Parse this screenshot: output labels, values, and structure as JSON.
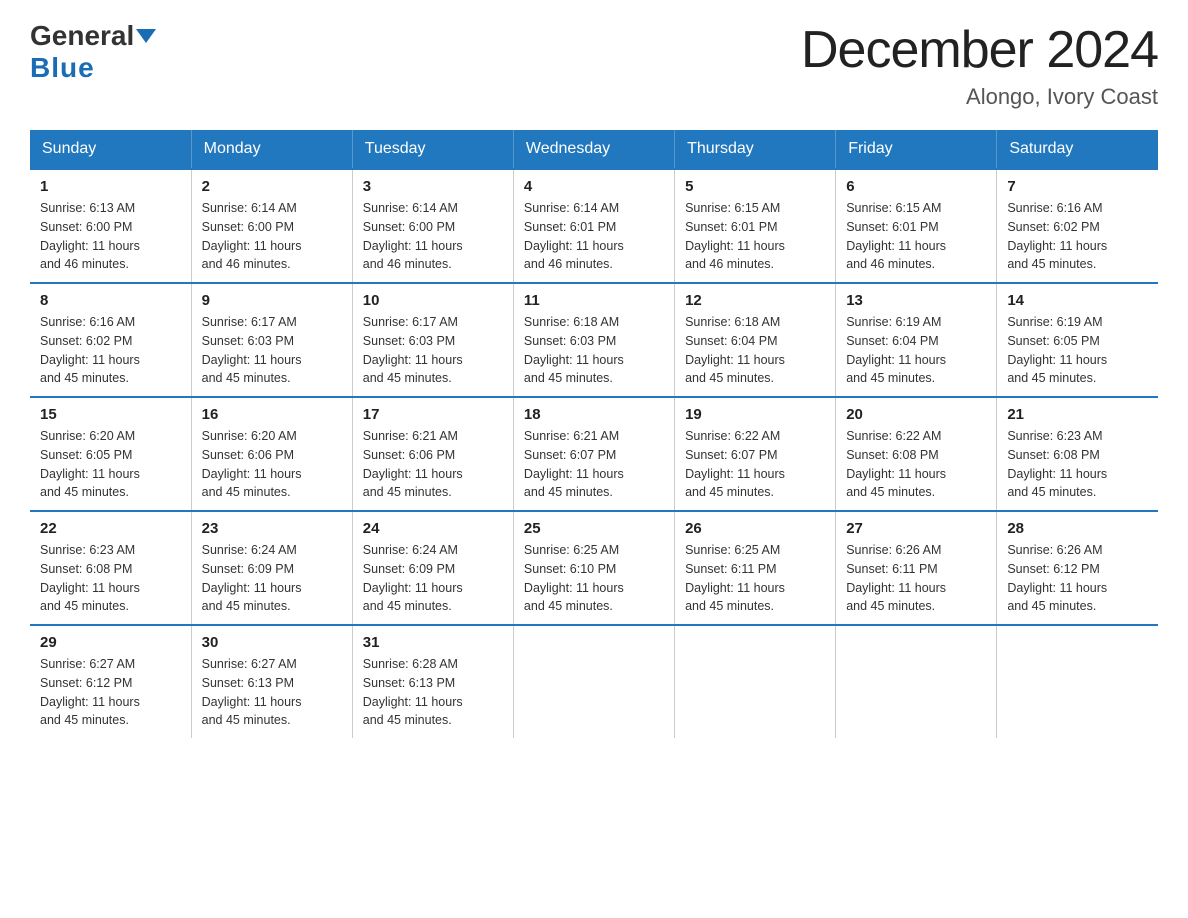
{
  "logo": {
    "general": "General",
    "blue": "Blue"
  },
  "title": "December 2024",
  "location": "Alongo, Ivory Coast",
  "headers": [
    "Sunday",
    "Monday",
    "Tuesday",
    "Wednesday",
    "Thursday",
    "Friday",
    "Saturday"
  ],
  "weeks": [
    [
      {
        "day": "1",
        "sunrise": "6:13 AM",
        "sunset": "6:00 PM",
        "daylight": "11 hours and 46 minutes."
      },
      {
        "day": "2",
        "sunrise": "6:14 AM",
        "sunset": "6:00 PM",
        "daylight": "11 hours and 46 minutes."
      },
      {
        "day": "3",
        "sunrise": "6:14 AM",
        "sunset": "6:00 PM",
        "daylight": "11 hours and 46 minutes."
      },
      {
        "day": "4",
        "sunrise": "6:14 AM",
        "sunset": "6:01 PM",
        "daylight": "11 hours and 46 minutes."
      },
      {
        "day": "5",
        "sunrise": "6:15 AM",
        "sunset": "6:01 PM",
        "daylight": "11 hours and 46 minutes."
      },
      {
        "day": "6",
        "sunrise": "6:15 AM",
        "sunset": "6:01 PM",
        "daylight": "11 hours and 46 minutes."
      },
      {
        "day": "7",
        "sunrise": "6:16 AM",
        "sunset": "6:02 PM",
        "daylight": "11 hours and 45 minutes."
      }
    ],
    [
      {
        "day": "8",
        "sunrise": "6:16 AM",
        "sunset": "6:02 PM",
        "daylight": "11 hours and 45 minutes."
      },
      {
        "day": "9",
        "sunrise": "6:17 AM",
        "sunset": "6:03 PM",
        "daylight": "11 hours and 45 minutes."
      },
      {
        "day": "10",
        "sunrise": "6:17 AM",
        "sunset": "6:03 PM",
        "daylight": "11 hours and 45 minutes."
      },
      {
        "day": "11",
        "sunrise": "6:18 AM",
        "sunset": "6:03 PM",
        "daylight": "11 hours and 45 minutes."
      },
      {
        "day": "12",
        "sunrise": "6:18 AM",
        "sunset": "6:04 PM",
        "daylight": "11 hours and 45 minutes."
      },
      {
        "day": "13",
        "sunrise": "6:19 AM",
        "sunset": "6:04 PM",
        "daylight": "11 hours and 45 minutes."
      },
      {
        "day": "14",
        "sunrise": "6:19 AM",
        "sunset": "6:05 PM",
        "daylight": "11 hours and 45 minutes."
      }
    ],
    [
      {
        "day": "15",
        "sunrise": "6:20 AM",
        "sunset": "6:05 PM",
        "daylight": "11 hours and 45 minutes."
      },
      {
        "day": "16",
        "sunrise": "6:20 AM",
        "sunset": "6:06 PM",
        "daylight": "11 hours and 45 minutes."
      },
      {
        "day": "17",
        "sunrise": "6:21 AM",
        "sunset": "6:06 PM",
        "daylight": "11 hours and 45 minutes."
      },
      {
        "day": "18",
        "sunrise": "6:21 AM",
        "sunset": "6:07 PM",
        "daylight": "11 hours and 45 minutes."
      },
      {
        "day": "19",
        "sunrise": "6:22 AM",
        "sunset": "6:07 PM",
        "daylight": "11 hours and 45 minutes."
      },
      {
        "day": "20",
        "sunrise": "6:22 AM",
        "sunset": "6:08 PM",
        "daylight": "11 hours and 45 minutes."
      },
      {
        "day": "21",
        "sunrise": "6:23 AM",
        "sunset": "6:08 PM",
        "daylight": "11 hours and 45 minutes."
      }
    ],
    [
      {
        "day": "22",
        "sunrise": "6:23 AM",
        "sunset": "6:08 PM",
        "daylight": "11 hours and 45 minutes."
      },
      {
        "day": "23",
        "sunrise": "6:24 AM",
        "sunset": "6:09 PM",
        "daylight": "11 hours and 45 minutes."
      },
      {
        "day": "24",
        "sunrise": "6:24 AM",
        "sunset": "6:09 PM",
        "daylight": "11 hours and 45 minutes."
      },
      {
        "day": "25",
        "sunrise": "6:25 AM",
        "sunset": "6:10 PM",
        "daylight": "11 hours and 45 minutes."
      },
      {
        "day": "26",
        "sunrise": "6:25 AM",
        "sunset": "6:11 PM",
        "daylight": "11 hours and 45 minutes."
      },
      {
        "day": "27",
        "sunrise": "6:26 AM",
        "sunset": "6:11 PM",
        "daylight": "11 hours and 45 minutes."
      },
      {
        "day": "28",
        "sunrise": "6:26 AM",
        "sunset": "6:12 PM",
        "daylight": "11 hours and 45 minutes."
      }
    ],
    [
      {
        "day": "29",
        "sunrise": "6:27 AM",
        "sunset": "6:12 PM",
        "daylight": "11 hours and 45 minutes."
      },
      {
        "day": "30",
        "sunrise": "6:27 AM",
        "sunset": "6:13 PM",
        "daylight": "11 hours and 45 minutes."
      },
      {
        "day": "31",
        "sunrise": "6:28 AM",
        "sunset": "6:13 PM",
        "daylight": "11 hours and 45 minutes."
      },
      null,
      null,
      null,
      null
    ]
  ],
  "labels": {
    "sunrise": "Sunrise:",
    "sunset": "Sunset:",
    "daylight": "Daylight:"
  }
}
